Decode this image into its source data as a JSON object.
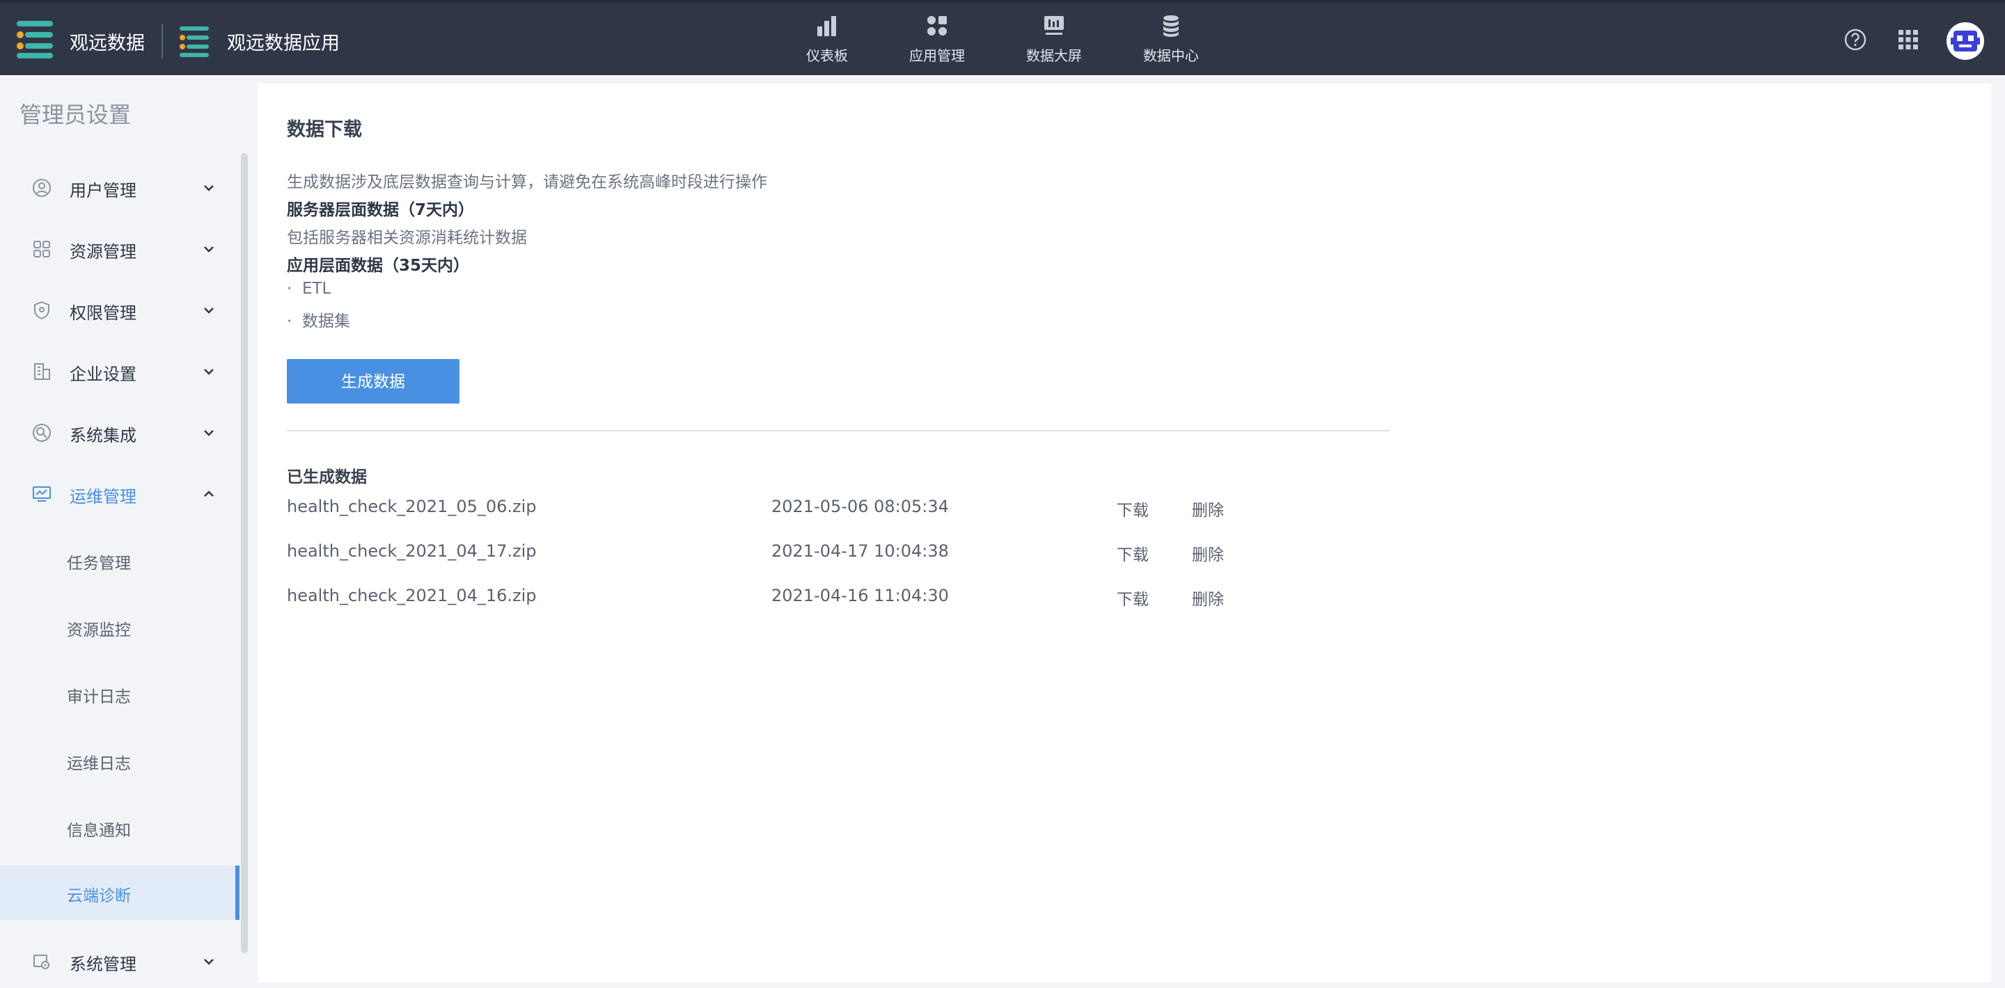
{
  "header": {
    "brand_name": "观远数据",
    "app_name": "观远数据应用",
    "nav": [
      {
        "label": "仪表板",
        "icon": "bar-chart-icon"
      },
      {
        "label": "应用管理",
        "icon": "apps-grid-icon"
      },
      {
        "label": "数据大屏",
        "icon": "big-screen-icon"
      },
      {
        "label": "数据中心",
        "icon": "database-icon"
      }
    ],
    "help_icon": "help-icon",
    "apps_icon": "app-launcher-icon",
    "avatar": "user-avatar"
  },
  "sidebar": {
    "title": "管理员设置",
    "items": [
      {
        "label": "用户管理",
        "icon": "user-icon"
      },
      {
        "label": "资源管理",
        "icon": "resource-icon"
      },
      {
        "label": "权限管理",
        "icon": "shield-icon"
      },
      {
        "label": "企业设置",
        "icon": "building-icon"
      },
      {
        "label": "系统集成",
        "icon": "integration-icon"
      },
      {
        "label": "运维管理",
        "icon": "monitor-icon",
        "expanded": true
      }
    ],
    "sub_items": [
      {
        "label": "任务管理"
      },
      {
        "label": "资源监控"
      },
      {
        "label": "审计日志"
      },
      {
        "label": "运维日志"
      },
      {
        "label": "信息通知"
      },
      {
        "label": "云端诊断",
        "selected": true
      }
    ],
    "last_item": {
      "label": "系统管理",
      "icon": "system-settings-icon"
    }
  },
  "main": {
    "title": "数据下载",
    "note": "生成数据涉及底层数据查询与计算，请避免在系统高峰时段进行操作",
    "server_heading": "服务器层面数据（7天内）",
    "server_desc": "包括服务器相关资源消耗统计数据",
    "app_heading": "应用层面数据（35天内）",
    "app_bullets": [
      "ETL",
      "数据集"
    ],
    "bullet_mark": "·",
    "generate_button": "生成数据",
    "generated_title": "已生成数据",
    "files": [
      {
        "name": "health_check_2021_05_06.zip",
        "time": "2021-05-06 08:05:34",
        "download": "下载",
        "delete": "删除"
      },
      {
        "name": "health_check_2021_04_17.zip",
        "time": "2021-04-17 10:04:38",
        "download": "下载",
        "delete": "删除"
      },
      {
        "name": "health_check_2021_04_16.zip",
        "time": "2021-04-16 11:04:30",
        "download": "下载",
        "delete": "删除"
      }
    ]
  },
  "colors": {
    "header_bg": "#2f3747",
    "accent": "#4a90e2",
    "brand_teal": "#3fb6aa",
    "brand_orange": "#f5a623"
  }
}
